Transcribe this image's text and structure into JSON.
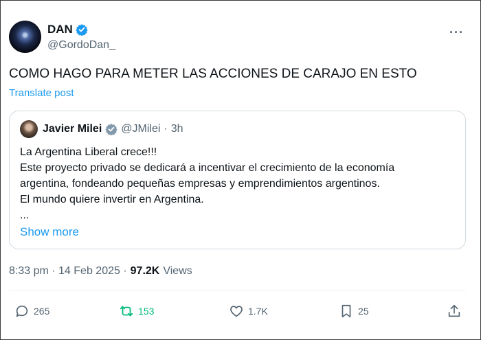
{
  "author": {
    "name": "DAN",
    "handle": "@GordoDan_"
  },
  "tweet": {
    "text": "COMO HAGO PARA METER LAS ACCIONES DE CARAJO EN ESTO",
    "translate_label": "Translate post",
    "timestamp": "8:33 pm · 14 Feb 2025 ·",
    "views_count": "97.2K",
    "views_label": "Views"
  },
  "quote": {
    "name": "Javier Milei",
    "handle": "@JMilei",
    "separator": "·",
    "time": "3h",
    "body": "La Argentina Liberal crece!!!\nEste proyecto privado se dedicará a incentivar el crecimiento de la economía\nargentina, fondeando pequeñas empresas y emprendimientos argentinos.\nEl mundo quiere invertir en Argentina.\n...",
    "show_more": "Show more"
  },
  "actions": {
    "replies": "265",
    "retweets": "153",
    "likes": "1.7K",
    "bookmarks": "25"
  },
  "icons": [
    "verified-badge-icon",
    "more-icon",
    "reply-icon",
    "retweet-icon",
    "like-icon",
    "bookmark-icon",
    "share-icon"
  ],
  "colors": {
    "link": "#1d9bf0",
    "retweet_active": "#00ba7c",
    "muted": "#536471",
    "verified_blue": "#1d9bf0",
    "verified_gray": "#829aab"
  }
}
